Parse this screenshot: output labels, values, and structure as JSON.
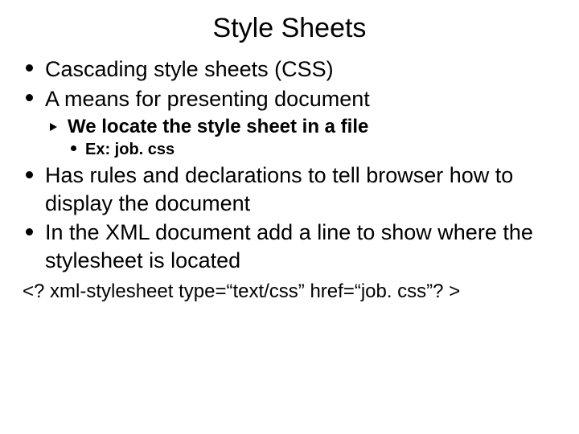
{
  "title": "Style Sheets",
  "b1": "Cascading style sheets (CSS)",
  "b2": "A means for presenting document",
  "b2_1": "We locate the style sheet in a file",
  "b2_1_1": "Ex:  job. css",
  "b3": "Has rules and declarations to tell browser how to display the document",
  "b4": "In the XML document add a line to show where the stylesheet is located",
  "footer": "<? xml-stylesheet type=“text/css” href=“job. css”? >"
}
